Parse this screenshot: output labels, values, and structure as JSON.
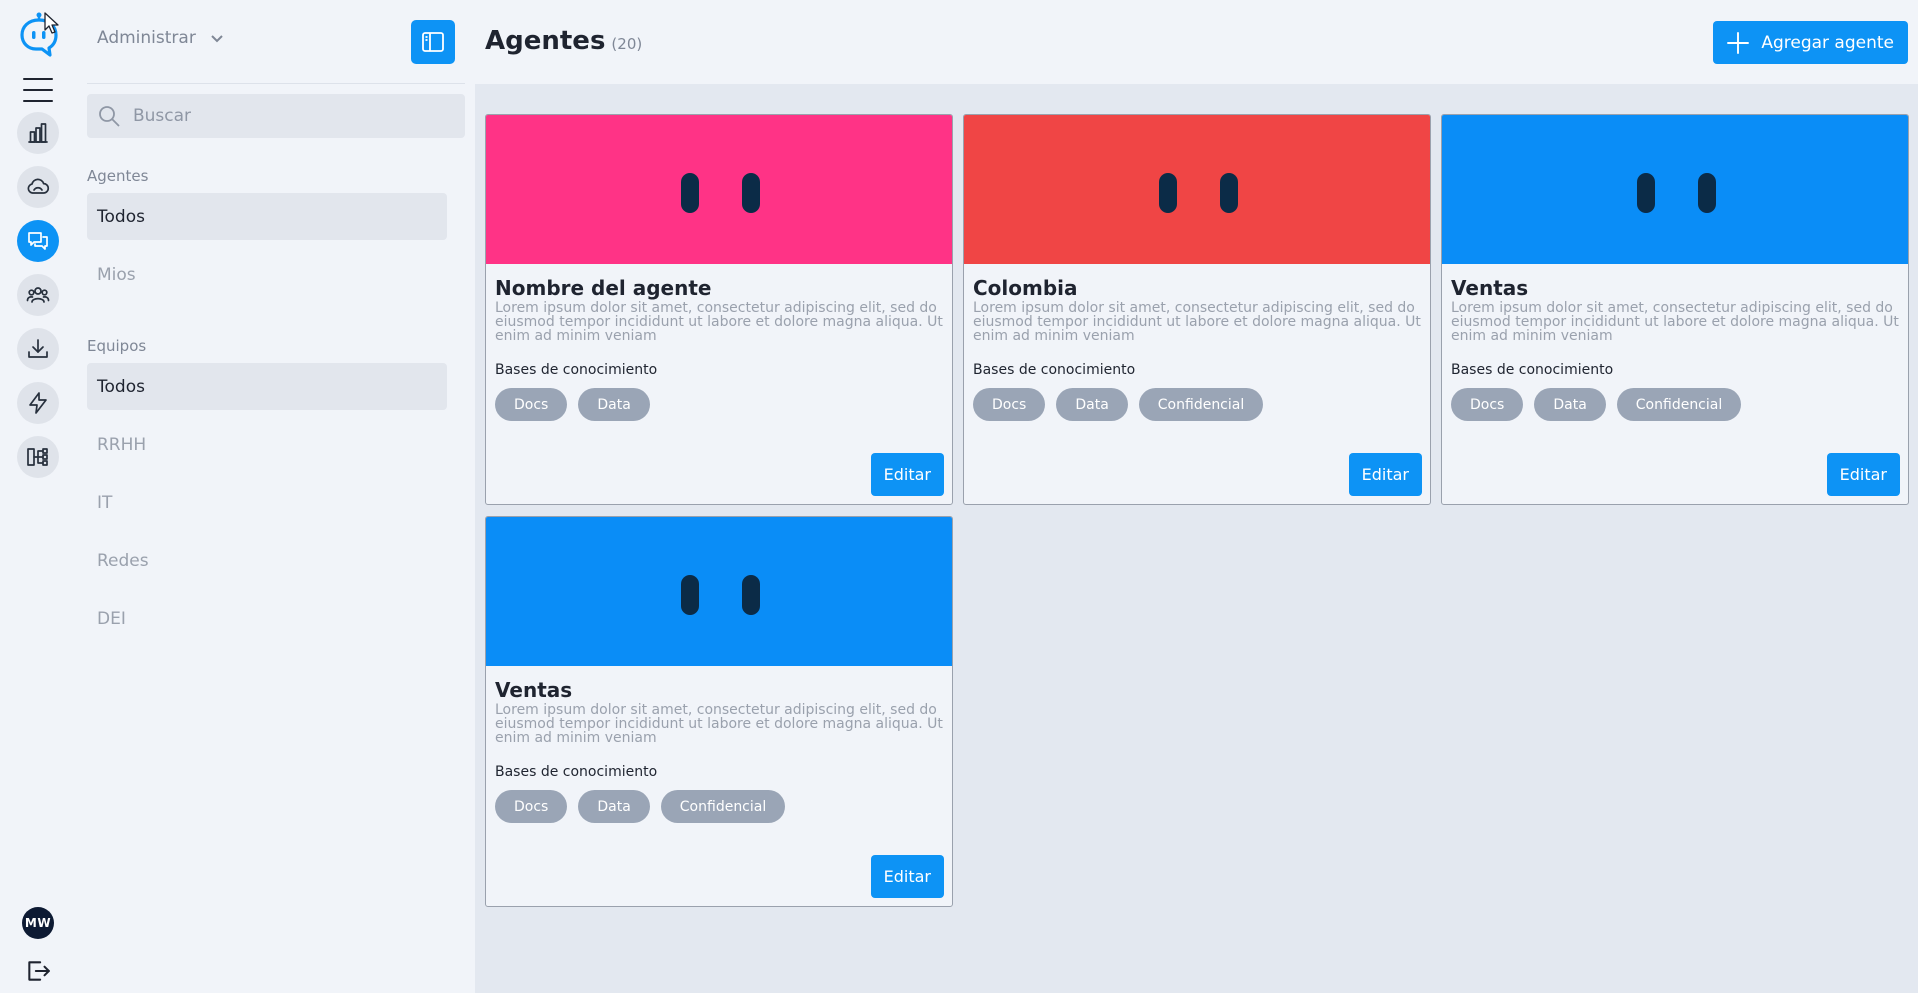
{
  "rail": {
    "items": [
      {
        "icon": "chart-icon",
        "active": false
      },
      {
        "icon": "cloud-icon",
        "active": false
      },
      {
        "icon": "chat-icon",
        "active": true
      },
      {
        "icon": "users-icon",
        "active": false
      },
      {
        "icon": "download-icon",
        "active": false
      },
      {
        "icon": "lightning-icon",
        "active": false
      },
      {
        "icon": "flow-icon",
        "active": false
      }
    ],
    "avatar_initials": "MW",
    "accent": "#0d93f5"
  },
  "sidebar": {
    "workspace": "Administrar",
    "search_placeholder": "Buscar",
    "agents_label": "Agentes",
    "agents_items": [
      "Todos",
      "Mios"
    ],
    "teams_label": "Equipos",
    "teams_items": [
      "Todos",
      "RRHH",
      "IT",
      "Redes",
      "DEI"
    ]
  },
  "header": {
    "title": "Agentes",
    "count": "(20)",
    "add_button": "Agregar agente"
  },
  "cards": [
    {
      "name": "Nombre del agente",
      "color": "#ff3386",
      "description": "Lorem ipsum dolor sit amet, consectetur adipiscing elit, sed do eiusmod tempor incididunt ut labore et dolore magna aliqua. Ut enim ad minim veniam",
      "kb_label": "Bases de conocimiento",
      "tags": [
        "Docs",
        "Data"
      ],
      "edit": "Editar"
    },
    {
      "name": "Colombia",
      "color": "#f04545",
      "description": "Lorem ipsum dolor sit amet, consectetur adipiscing elit, sed do eiusmod tempor incididunt ut labore et dolore magna aliqua. Ut enim ad minim veniam",
      "kb_label": "Bases de conocimiento",
      "tags": [
        "Docs",
        "Data",
        "Confidencial"
      ],
      "edit": "Editar"
    },
    {
      "name": "Ventas",
      "color": "#0a8df7",
      "description": "Lorem ipsum dolor sit amet, consectetur adipiscing elit, sed do eiusmod tempor incididunt ut labore et dolore magna aliqua. Ut enim ad minim veniam",
      "kb_label": "Bases de conocimiento",
      "tags": [
        "Docs",
        "Data",
        "Confidencial"
      ],
      "edit": "Editar"
    },
    {
      "name": "Ventas",
      "color": "#0a8df7",
      "description": "Lorem ipsum dolor sit amet, consectetur adipiscing elit, sed do eiusmod tempor incididunt ut labore et dolore magna aliqua. Ut enim ad minim veniam",
      "kb_label": "Bases de conocimiento",
      "tags": [
        "Docs",
        "Data",
        "Confidencial"
      ],
      "edit": "Editar"
    }
  ]
}
